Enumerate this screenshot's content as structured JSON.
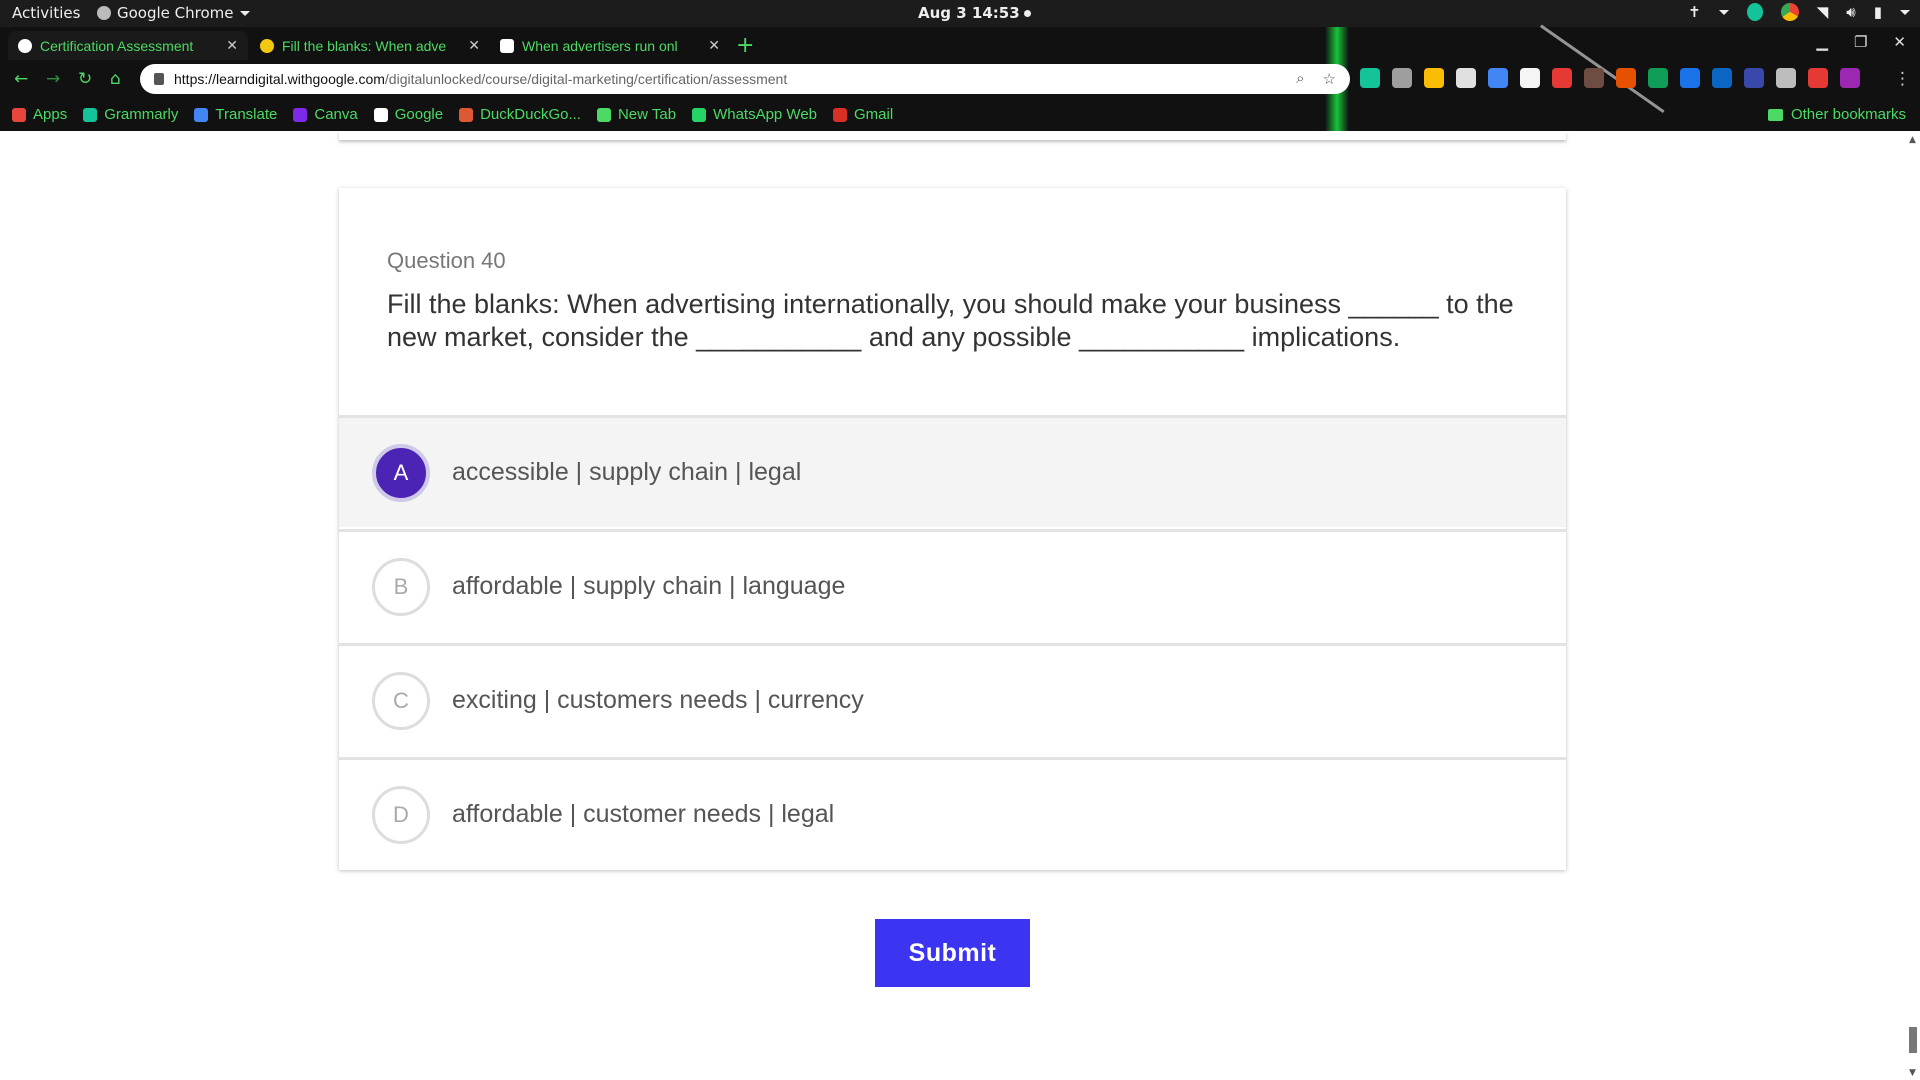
{
  "system_bar": {
    "activities": "Activities",
    "app_name": "Google Chrome",
    "clock": "Aug 3  14:53"
  },
  "browser": {
    "tabs": [
      {
        "title": "Certification Assessment",
        "favicon_color": "#ffffff"
      },
      {
        "title": "Fill the blanks: When adve",
        "favicon_color": "#f2c811"
      },
      {
        "title": "When advertisers run onl",
        "favicon_color": "#ffffff"
      }
    ],
    "url_host": "https://learndigital.withgoogle.com",
    "url_path": "/digitalunlocked/course/digital-marketing/certification/assessment",
    "bookmarks": [
      {
        "label": "Apps",
        "color": "#e8453c"
      },
      {
        "label": "Grammarly",
        "color": "#15c39a"
      },
      {
        "label": "Translate",
        "color": "#4285f4"
      },
      {
        "label": "Canva",
        "color": "#7d2ae8"
      },
      {
        "label": "Google",
        "color": "#ffffff"
      },
      {
        "label": "DuckDuckGo...",
        "color": "#de5833"
      },
      {
        "label": "New Tab",
        "color": "#4cd964"
      },
      {
        "label": "WhatsApp Web",
        "color": "#25d366"
      },
      {
        "label": "Gmail",
        "color": "#d93025"
      }
    ],
    "other_bookmarks": "Other bookmarks",
    "extension_colors": [
      "#15c39a",
      "#9e9e9e",
      "#fbbc04",
      "#e0e0e0",
      "#4285f4",
      "#f5f5f5",
      "#e53935",
      "#6d4c41",
      "#e65100",
      "#0f9d58",
      "#1a73e8",
      "#0a66c2",
      "#3949ab",
      "#bdbdbd",
      "#e53935",
      "#9c27b0"
    ]
  },
  "quiz": {
    "question_number": "Question 40",
    "question_text": "Fill the blanks: When advertising internationally, you should make your business ______ to the new market, consider the ___________ and any possible ___________ implications.",
    "options": [
      {
        "letter": "A",
        "text": "accessible | supply chain | legal",
        "selected": true
      },
      {
        "letter": "B",
        "text": "affordable | supply chain | language",
        "selected": false
      },
      {
        "letter": "C",
        "text": "exciting | customers needs | currency",
        "selected": false
      },
      {
        "letter": "D",
        "text": "affordable | customer needs | legal",
        "selected": false
      }
    ],
    "submit_label": "Submit",
    "accent_color": "#4b24b5",
    "submit_color": "#3b34f0"
  }
}
